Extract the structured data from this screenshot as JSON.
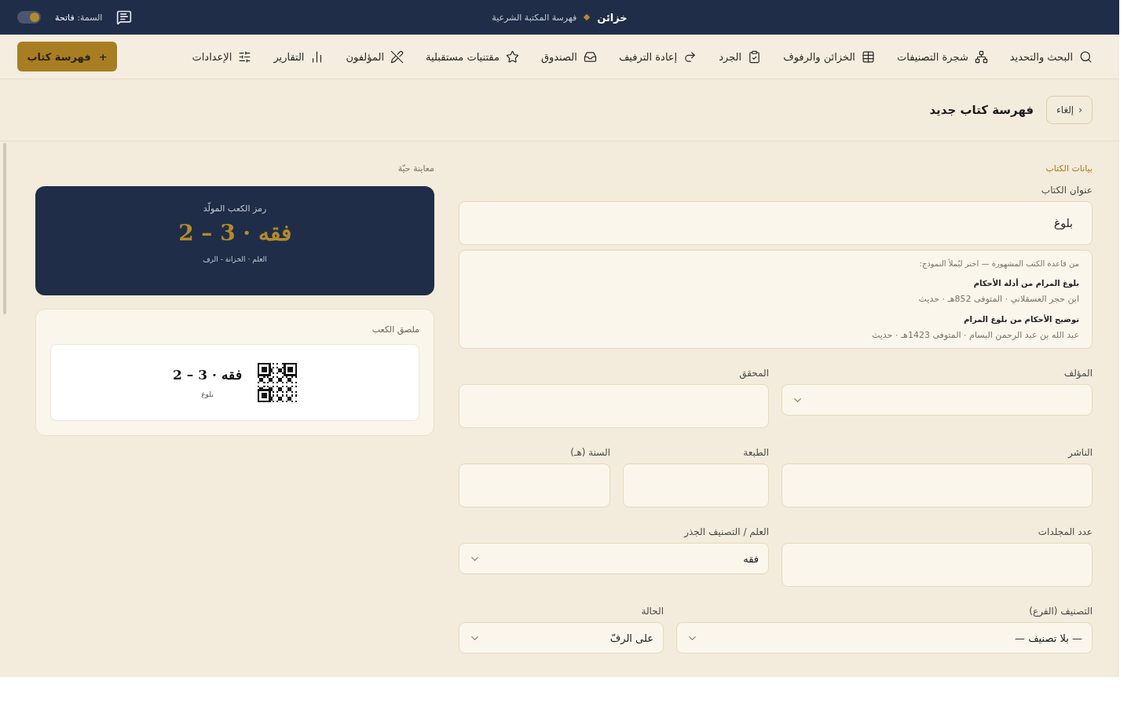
{
  "topbar": {
    "brand": "خزائن",
    "subtitle": "فهرسة المكتبة الشرعية",
    "theme_label": "السمة:",
    "theme_value": "فاتحة",
    "theme_toggle_on": true
  },
  "nav": {
    "items": [
      {
        "label": "البحث والتحديد"
      },
      {
        "label": "شجرة التصنيفات"
      },
      {
        "label": "الخزائن والرفوف"
      },
      {
        "label": "الجرد"
      },
      {
        "label": "إعادة الترفيف"
      },
      {
        "label": "الصندوق"
      },
      {
        "label": "مقتنيات مستقبلية"
      },
      {
        "label": "المؤلفون"
      },
      {
        "label": "التقارير"
      },
      {
        "label": "الإعدادات"
      }
    ],
    "primary_button": {
      "icon_text": "+",
      "label": "فهرسة كتاب"
    }
  },
  "header": {
    "cancel_button": {
      "icon_text": "‹",
      "label": "إلغاء"
    },
    "title": "فهرسة كتاب جديد"
  },
  "form": {
    "section_title": "بيانات الكتاب",
    "title_field": {
      "label": "عنوان الكتاب",
      "value": "بلوغ"
    },
    "suggestions": {
      "hint": "من قاعدة الكتب المشهورة — اختر ليُملأ النموذج:",
      "items": [
        {
          "title": "بلوغ المرام من أدلة الأحكام",
          "meta": "ابن حجر العسقلاني · المتوفى 852هـ · حديث"
        },
        {
          "title": "توضيح الأحكام من بلوغ المرام",
          "meta": "عبد الله بن عبد الرحمن البسام · المتوفى 1423هـ · حديث"
        }
      ]
    },
    "rows": [
      [
        {
          "kind": "select",
          "label": "المؤلف"
        },
        {
          "kind": "text",
          "label": "المحقق"
        }
      ],
      [
        {
          "kind": "text",
          "label": "الناشر"
        },
        {
          "kind": "text",
          "label": "الطبعة"
        },
        {
          "kind": "text",
          "label": "السنة (هـ)"
        }
      ],
      [
        {
          "kind": "text",
          "label": "عدد المجلدات"
        },
        {
          "kind": "select",
          "label": "العلم / التصنيف الجذر",
          "value": "فقه"
        }
      ],
      [
        {
          "kind": "select",
          "label": "التصنيف (الفرع)",
          "value": "— بلا تصنيف —"
        },
        {
          "kind": "select",
          "label": "الحالة",
          "value": "على الرفّ"
        }
      ]
    ]
  },
  "preview": {
    "title": "معاينة حيّة",
    "code_card": {
      "caption": "رمز الكعب المولّد",
      "code": "فقه · 3 – 2",
      "legend": "العلم · الخزانة - الرف"
    },
    "label_card": {
      "title": "ملصق الكعب",
      "code": "فقه · 3 – 2",
      "book": "بلوغ"
    }
  }
}
